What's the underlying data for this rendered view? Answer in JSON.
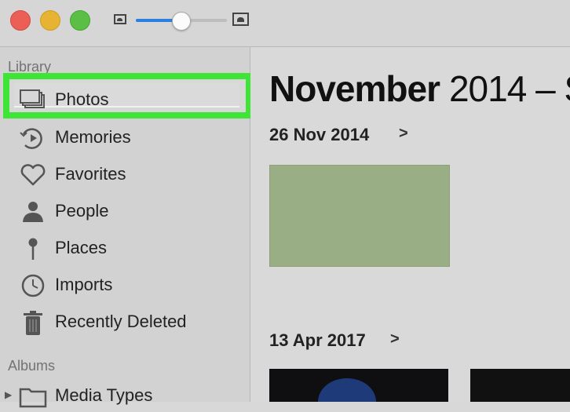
{
  "toolbar": {
    "zoom_level": 0.49
  },
  "sidebar": {
    "library_header": "Library",
    "items": [
      {
        "label": "Photos",
        "icon": "photos-icon"
      },
      {
        "label": "Memories",
        "icon": "memories-icon"
      },
      {
        "label": "Favorites",
        "icon": "heart-icon"
      },
      {
        "label": "People",
        "icon": "person-icon"
      },
      {
        "label": "Places",
        "icon": "pin-icon"
      },
      {
        "label": "Imports",
        "icon": "clock-icon"
      },
      {
        "label": "Recently Deleted",
        "icon": "trash-icon"
      }
    ],
    "albums_header": "Albums",
    "albums_items": [
      {
        "label": "Media Types",
        "icon": "folder-icon"
      }
    ]
  },
  "main": {
    "month_bold": "November",
    "month_range": "2014 – S",
    "groups": [
      {
        "date": "26 Nov 2014",
        "chevron": ">"
      },
      {
        "date": "13 Apr 2017",
        "chevron": ">"
      }
    ]
  },
  "colors": {
    "highlight": "#3fe536",
    "photo_green": "#9aae86",
    "slider_fill": "#2a7fe0"
  }
}
